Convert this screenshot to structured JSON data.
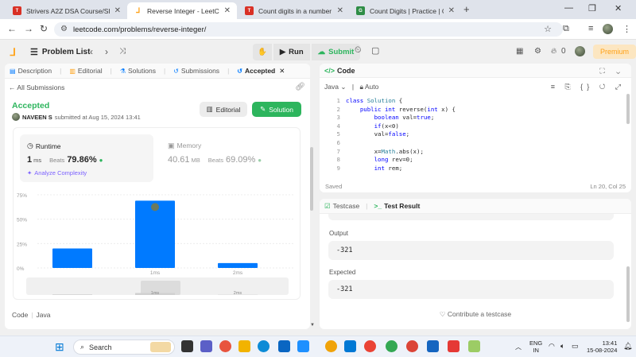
{
  "browser": {
    "tabs": [
      {
        "title": "Strivers A2Z DSA Course/Sheet",
        "favicon": "tuf"
      },
      {
        "title": "Reverse Integer - LeetCode",
        "favicon": "leetcode",
        "active": true
      },
      {
        "title": "Count digits in a number - Tuto",
        "favicon": "tuf"
      },
      {
        "title": "Count Digits | Practice | Geeksfo",
        "favicon": "gfg"
      }
    ],
    "url": "leetcode.com/problems/reverse-integer/"
  },
  "lc_header": {
    "problem_list": "Problem List",
    "run_label": "Run",
    "submit_label": "Submit",
    "streak_count": "0",
    "premium_label": "Premium"
  },
  "left_tabs": [
    {
      "label": "Description",
      "icon": "document-icon"
    },
    {
      "label": "Editorial",
      "icon": "book-icon"
    },
    {
      "label": "Solutions",
      "icon": "flask-icon"
    },
    {
      "label": "Submissions",
      "icon": "history-icon"
    },
    {
      "label": "Accepted",
      "icon": "history-icon",
      "active": true
    }
  ],
  "submission": {
    "back_label": "All Submissions",
    "status": "Accepted",
    "user": "NAVEEN S",
    "submitted_text": "submitted at Aug 15, 2024 13:41",
    "editorial_btn": "Editorial",
    "solution_btn": "Solution",
    "runtime": {
      "label": "Runtime",
      "value": "1",
      "unit": "ms",
      "beats_label": "Beats",
      "beats": "79.86%"
    },
    "memory": {
      "label": "Memory",
      "value": "40.61",
      "unit": "MB",
      "beats_label": "Beats",
      "beats": "69.09%"
    },
    "analyze_label": "Analyze Complexity",
    "code_lang_line": {
      "code": "Code",
      "lang": "Java"
    }
  },
  "chart_data": {
    "type": "bar",
    "categories": [
      "",
      "1ms",
      "2ms"
    ],
    "values": [
      20,
      69,
      5
    ],
    "yticks": [
      "0%",
      "25%",
      "50%",
      "75%"
    ],
    "ylim": [
      0,
      75
    ],
    "bar_color": "#007aff",
    "highlight_index": 1
  },
  "editor": {
    "title": "Code",
    "language": "Java",
    "mode": "Auto",
    "lines": [
      "class Solution {",
      "    public int reverse(int x) {",
      "        boolean val=true;",
      "        if(x<0)",
      "        val=false;",
      "",
      "        x=Math.abs(x);",
      "        long rev=0;",
      "        int rem;"
    ],
    "status": "Saved",
    "cursor": "Ln 20, Col 25"
  },
  "test": {
    "tab_testcase": "Testcase",
    "tab_result": "Test Result",
    "output_label": "Output",
    "output_value": "-321",
    "expected_label": "Expected",
    "expected_value": "-321",
    "contribute": "Contribute a testcase"
  },
  "taskbar": {
    "search": "Search",
    "lang": "ENG",
    "region": "IN",
    "time": "13:41",
    "date": "15-08-2024"
  }
}
